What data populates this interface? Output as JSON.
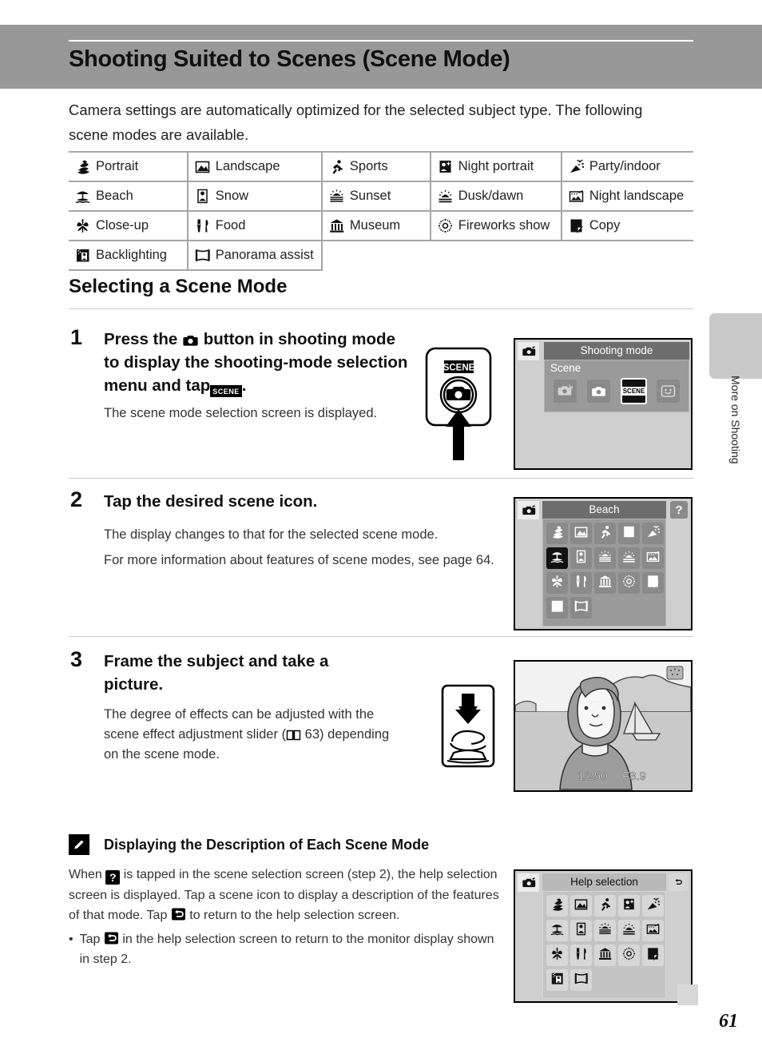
{
  "header": {
    "title": "Shooting Suited to Scenes (Scene Mode)",
    "band_color": "#989898"
  },
  "intro": "Camera settings are automatically optimized for the selected subject type. The following scene modes are available.",
  "scene_table": {
    "rows": [
      [
        {
          "icon": "portrait-icon",
          "label": "Portrait"
        },
        {
          "icon": "landscape-icon",
          "label": "Landscape"
        },
        {
          "icon": "sports-icon",
          "label": "Sports"
        },
        {
          "icon": "night-portrait-icon",
          "label": "Night portrait"
        },
        {
          "icon": "party-indoor-icon",
          "label": "Party/indoor"
        }
      ],
      [
        {
          "icon": "beach-icon",
          "label": "Beach"
        },
        {
          "icon": "snow-icon",
          "label": "Snow"
        },
        {
          "icon": "sunset-icon",
          "label": "Sunset"
        },
        {
          "icon": "dusk-dawn-icon",
          "label": "Dusk/dawn"
        },
        {
          "icon": "night-landscape-icon",
          "label": "Night landscape"
        }
      ],
      [
        {
          "icon": "close-up-icon",
          "label": "Close-up"
        },
        {
          "icon": "food-icon",
          "label": "Food"
        },
        {
          "icon": "museum-icon",
          "label": "Museum"
        },
        {
          "icon": "fireworks-icon",
          "label": "Fireworks show"
        },
        {
          "icon": "copy-icon",
          "label": "Copy"
        }
      ],
      [
        {
          "icon": "backlighting-icon",
          "label": "Backlighting"
        },
        {
          "icon": "panorama-assist-icon",
          "label": "Panorama assist"
        }
      ]
    ]
  },
  "section_heading": "Selecting a Scene Mode",
  "steps": [
    {
      "number": "1",
      "title_before": "Press the",
      "title_mid": "button in shooting mode to display the shooting-mode selection menu and tap",
      "title_after": ".",
      "scene_tag": "SCENE",
      "body": [
        "The scene mode selection screen is displayed."
      ]
    },
    {
      "number": "2",
      "title": "Tap the desired scene icon.",
      "body": [
        "The display changes to that for the selected scene mode.",
        "For more information about features of scene modes, see page 64."
      ]
    },
    {
      "number": "3",
      "title": "Frame the subject and take a picture.",
      "body": [
        "The degree of effects can be adjusted with the scene effect adjustment slider (\u0001 63) depending on the scene mode."
      ],
      "body_before": "The degree of effects can be adjusted with the scene effect adjustment slider (",
      "body_page_ref": "63",
      "body_after": ") depending on the scene mode."
    }
  ],
  "camera_button_illustration": {
    "label": "SCENE",
    "icon": "camera-button-icon",
    "arrow": "up-arrow-icon"
  },
  "shutter_illustration": {
    "arrow": "down-arrow-icon",
    "icon": "finger-press-icon"
  },
  "lcd_shooting_mode": {
    "tab_icon": "camera-icon",
    "title": "Shooting mode",
    "subtitle": "Scene",
    "tiles": [
      {
        "name": "auto-scene-tile",
        "icon": "auto-scene-icon",
        "selected": false
      },
      {
        "name": "auto-mode-tile",
        "icon": "camera-icon",
        "selected": false
      },
      {
        "name": "scene-mode-tile",
        "icon": "scene-icon",
        "selected": true,
        "label": "SCENE"
      },
      {
        "name": "smart-portrait-tile",
        "icon": "smile-icon",
        "selected": false
      }
    ]
  },
  "lcd_scene_selection": {
    "tab_icon": "camera-icon",
    "title": "Beach",
    "help_button": "?",
    "selected_index": 5,
    "tiles": [
      "portrait-icon",
      "landscape-icon",
      "sports-icon",
      "night-portrait-icon",
      "party-indoor-icon",
      "beach-icon",
      "snow-icon",
      "sunset-icon",
      "dusk-dawn-icon",
      "night-landscape-icon",
      "close-up-icon",
      "food-icon",
      "museum-icon",
      "fireworks-icon",
      "copy-icon",
      "backlighting-icon",
      "panorama-assist-icon"
    ]
  },
  "lcd_photo": {
    "shutter_speed": "1/250",
    "aperture": "F3.9",
    "mode_icon": "fireworks-indicator-icon"
  },
  "lcd_help_selection": {
    "tab_icon": "camera-icon",
    "title": "Help selection",
    "return_button": "return-icon",
    "tiles": [
      "portrait-icon",
      "landscape-icon",
      "sports-icon",
      "night-portrait-icon",
      "party-indoor-icon",
      "beach-icon",
      "snow-icon",
      "sunset-icon",
      "dusk-dawn-icon",
      "night-landscape-icon",
      "close-up-icon",
      "food-icon",
      "museum-icon",
      "fireworks-icon",
      "copy-icon",
      "backlighting-icon",
      "panorama-assist-icon"
    ]
  },
  "side_tab": {
    "label": "More on Shooting"
  },
  "note": {
    "icon": "pencil-icon",
    "title": "Displaying the Description of Each Scene Mode",
    "para_1a": "When",
    "para_1b": "is tapped in the scene selection screen (step 2), the help selection screen is displayed. Tap a scene icon to display a description of the features of that mode. Tap",
    "para_1c": "to return to the help selection screen.",
    "bullet_a": "Tap",
    "bullet_b": "in the help selection screen to return to the monitor display shown in step 2."
  },
  "page_number": "61"
}
